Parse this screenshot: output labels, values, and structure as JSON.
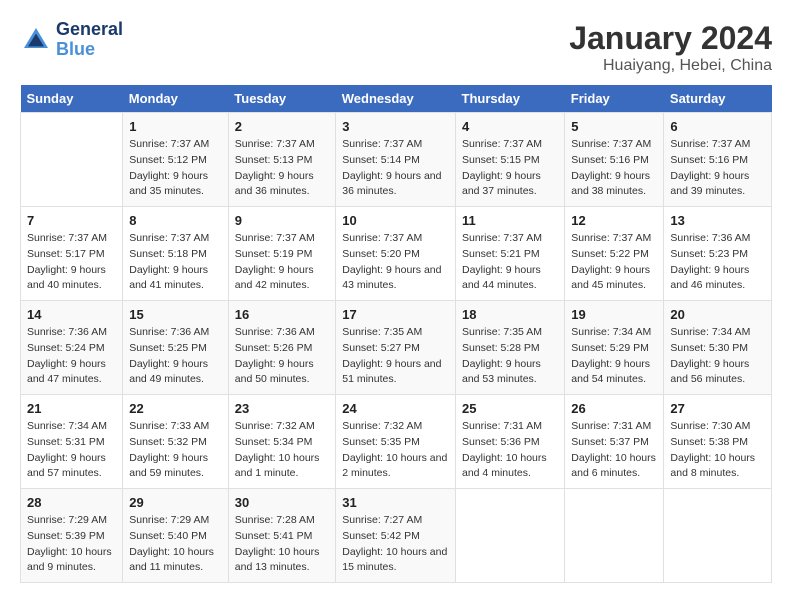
{
  "header": {
    "logo_line1": "General",
    "logo_line2": "Blue",
    "title": "January 2024",
    "subtitle": "Huaiyang, Hebei, China"
  },
  "weekdays": [
    "Sunday",
    "Monday",
    "Tuesday",
    "Wednesday",
    "Thursday",
    "Friday",
    "Saturday"
  ],
  "weeks": [
    [
      {
        "day": "",
        "sunrise": "",
        "sunset": "",
        "daylight": ""
      },
      {
        "day": "1",
        "sunrise": "Sunrise: 7:37 AM",
        "sunset": "Sunset: 5:12 PM",
        "daylight": "Daylight: 9 hours and 35 minutes."
      },
      {
        "day": "2",
        "sunrise": "Sunrise: 7:37 AM",
        "sunset": "Sunset: 5:13 PM",
        "daylight": "Daylight: 9 hours and 36 minutes."
      },
      {
        "day": "3",
        "sunrise": "Sunrise: 7:37 AM",
        "sunset": "Sunset: 5:14 PM",
        "daylight": "Daylight: 9 hours and 36 minutes."
      },
      {
        "day": "4",
        "sunrise": "Sunrise: 7:37 AM",
        "sunset": "Sunset: 5:15 PM",
        "daylight": "Daylight: 9 hours and 37 minutes."
      },
      {
        "day": "5",
        "sunrise": "Sunrise: 7:37 AM",
        "sunset": "Sunset: 5:16 PM",
        "daylight": "Daylight: 9 hours and 38 minutes."
      },
      {
        "day": "6",
        "sunrise": "Sunrise: 7:37 AM",
        "sunset": "Sunset: 5:16 PM",
        "daylight": "Daylight: 9 hours and 39 minutes."
      }
    ],
    [
      {
        "day": "7",
        "sunrise": "Sunrise: 7:37 AM",
        "sunset": "Sunset: 5:17 PM",
        "daylight": "Daylight: 9 hours and 40 minutes."
      },
      {
        "day": "8",
        "sunrise": "Sunrise: 7:37 AM",
        "sunset": "Sunset: 5:18 PM",
        "daylight": "Daylight: 9 hours and 41 minutes."
      },
      {
        "day": "9",
        "sunrise": "Sunrise: 7:37 AM",
        "sunset": "Sunset: 5:19 PM",
        "daylight": "Daylight: 9 hours and 42 minutes."
      },
      {
        "day": "10",
        "sunrise": "Sunrise: 7:37 AM",
        "sunset": "Sunset: 5:20 PM",
        "daylight": "Daylight: 9 hours and 43 minutes."
      },
      {
        "day": "11",
        "sunrise": "Sunrise: 7:37 AM",
        "sunset": "Sunset: 5:21 PM",
        "daylight": "Daylight: 9 hours and 44 minutes."
      },
      {
        "day": "12",
        "sunrise": "Sunrise: 7:37 AM",
        "sunset": "Sunset: 5:22 PM",
        "daylight": "Daylight: 9 hours and 45 minutes."
      },
      {
        "day": "13",
        "sunrise": "Sunrise: 7:36 AM",
        "sunset": "Sunset: 5:23 PM",
        "daylight": "Daylight: 9 hours and 46 minutes."
      }
    ],
    [
      {
        "day": "14",
        "sunrise": "Sunrise: 7:36 AM",
        "sunset": "Sunset: 5:24 PM",
        "daylight": "Daylight: 9 hours and 47 minutes."
      },
      {
        "day": "15",
        "sunrise": "Sunrise: 7:36 AM",
        "sunset": "Sunset: 5:25 PM",
        "daylight": "Daylight: 9 hours and 49 minutes."
      },
      {
        "day": "16",
        "sunrise": "Sunrise: 7:36 AM",
        "sunset": "Sunset: 5:26 PM",
        "daylight": "Daylight: 9 hours and 50 minutes."
      },
      {
        "day": "17",
        "sunrise": "Sunrise: 7:35 AM",
        "sunset": "Sunset: 5:27 PM",
        "daylight": "Daylight: 9 hours and 51 minutes."
      },
      {
        "day": "18",
        "sunrise": "Sunrise: 7:35 AM",
        "sunset": "Sunset: 5:28 PM",
        "daylight": "Daylight: 9 hours and 53 minutes."
      },
      {
        "day": "19",
        "sunrise": "Sunrise: 7:34 AM",
        "sunset": "Sunset: 5:29 PM",
        "daylight": "Daylight: 9 hours and 54 minutes."
      },
      {
        "day": "20",
        "sunrise": "Sunrise: 7:34 AM",
        "sunset": "Sunset: 5:30 PM",
        "daylight": "Daylight: 9 hours and 56 minutes."
      }
    ],
    [
      {
        "day": "21",
        "sunrise": "Sunrise: 7:34 AM",
        "sunset": "Sunset: 5:31 PM",
        "daylight": "Daylight: 9 hours and 57 minutes."
      },
      {
        "day": "22",
        "sunrise": "Sunrise: 7:33 AM",
        "sunset": "Sunset: 5:32 PM",
        "daylight": "Daylight: 9 hours and 59 minutes."
      },
      {
        "day": "23",
        "sunrise": "Sunrise: 7:32 AM",
        "sunset": "Sunset: 5:34 PM",
        "daylight": "Daylight: 10 hours and 1 minute."
      },
      {
        "day": "24",
        "sunrise": "Sunrise: 7:32 AM",
        "sunset": "Sunset: 5:35 PM",
        "daylight": "Daylight: 10 hours and 2 minutes."
      },
      {
        "day": "25",
        "sunrise": "Sunrise: 7:31 AM",
        "sunset": "Sunset: 5:36 PM",
        "daylight": "Daylight: 10 hours and 4 minutes."
      },
      {
        "day": "26",
        "sunrise": "Sunrise: 7:31 AM",
        "sunset": "Sunset: 5:37 PM",
        "daylight": "Daylight: 10 hours and 6 minutes."
      },
      {
        "day": "27",
        "sunrise": "Sunrise: 7:30 AM",
        "sunset": "Sunset: 5:38 PM",
        "daylight": "Daylight: 10 hours and 8 minutes."
      }
    ],
    [
      {
        "day": "28",
        "sunrise": "Sunrise: 7:29 AM",
        "sunset": "Sunset: 5:39 PM",
        "daylight": "Daylight: 10 hours and 9 minutes."
      },
      {
        "day": "29",
        "sunrise": "Sunrise: 7:29 AM",
        "sunset": "Sunset: 5:40 PM",
        "daylight": "Daylight: 10 hours and 11 minutes."
      },
      {
        "day": "30",
        "sunrise": "Sunrise: 7:28 AM",
        "sunset": "Sunset: 5:41 PM",
        "daylight": "Daylight: 10 hours and 13 minutes."
      },
      {
        "day": "31",
        "sunrise": "Sunrise: 7:27 AM",
        "sunset": "Sunset: 5:42 PM",
        "daylight": "Daylight: 10 hours and 15 minutes."
      },
      {
        "day": "",
        "sunrise": "",
        "sunset": "",
        "daylight": ""
      },
      {
        "day": "",
        "sunrise": "",
        "sunset": "",
        "daylight": ""
      },
      {
        "day": "",
        "sunrise": "",
        "sunset": "",
        "daylight": ""
      }
    ]
  ]
}
